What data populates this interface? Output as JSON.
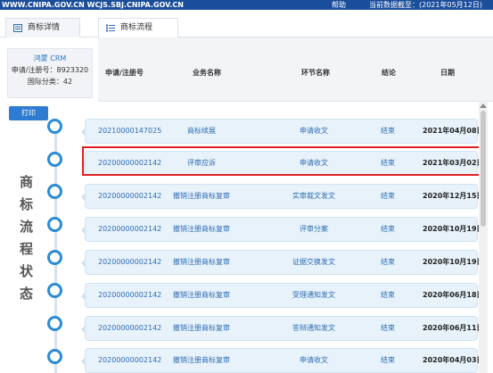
{
  "topbar": {
    "sites": "WWW.CNIPA.GOV.CN WCJS.SBJ.CNIPA.GOV.CN",
    "help": "帮助",
    "data_date": "当前数据截至：(2021年05月12日)"
  },
  "tabs": [
    {
      "label": "商标详情",
      "icon": "document-icon"
    },
    {
      "label": "商标流程",
      "icon": "list-icon"
    }
  ],
  "info": {
    "brand": "鸿蒙 CRM",
    "reg_no": "申请/注册号：8923320",
    "class": "国际分类：42"
  },
  "print_label": "打印",
  "vertical_title": [
    "商",
    "标",
    "流",
    "程",
    "状",
    "态"
  ],
  "columns": [
    "申请/注册号",
    "业务名称",
    "环节名称",
    "结论",
    "日期"
  ],
  "rows": [
    {
      "no": "20210000147025",
      "business": "商标续展",
      "step": "申请收文",
      "result": "结束",
      "date": "2021年04月08日"
    },
    {
      "no": "20200000002142",
      "business": "评审应诉",
      "step": "申请收文",
      "result": "结束",
      "date": "2021年03月02日"
    },
    {
      "no": "20200000002142",
      "business": "撤销注册商标复审",
      "step": "实审裁文发文",
      "result": "结束",
      "date": "2020年12月15日"
    },
    {
      "no": "20200000002142",
      "business": "撤销注册商标复审",
      "step": "评审分案",
      "result": "结束",
      "date": "2020年10月19日"
    },
    {
      "no": "20200000002142",
      "business": "撤销注册商标复审",
      "step": "证据交换发文",
      "result": "结束",
      "date": "2020年10月19日"
    },
    {
      "no": "20200000002142",
      "business": "撤销注册商标复审",
      "step": "受理通知发文",
      "result": "结束",
      "date": "2020年06月18日"
    },
    {
      "no": "20200000002142",
      "business": "撤销注册商标复审",
      "step": "答辩通知发文",
      "result": "结束",
      "date": "2020年06月11日"
    },
    {
      "no": "20200000002142",
      "business": "撤销注册商标复审",
      "step": "申请收文",
      "result": "结束",
      "date": "2020年04月03日"
    }
  ],
  "colors": {
    "accent": "#2d7cd1",
    "highlight": "#e02020",
    "row_bg": "#e7f2fb"
  }
}
